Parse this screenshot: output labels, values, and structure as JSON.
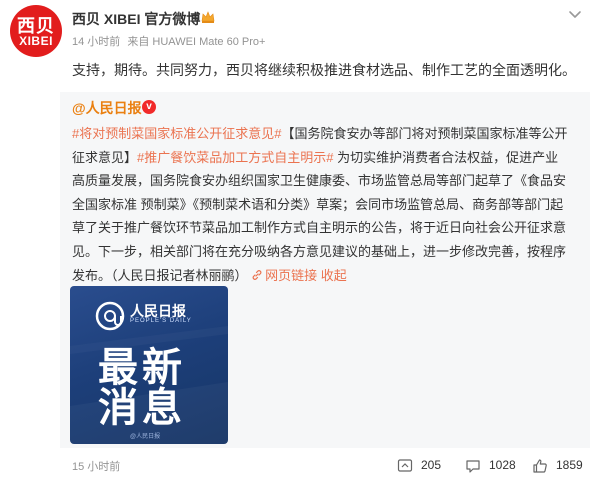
{
  "post": {
    "avatar": {
      "top": "西贝",
      "bottom": "XIBEI"
    },
    "author": "西贝 XIBEI 官方微博",
    "crown_icon": "crown-icon",
    "time": "14 小时前",
    "source": "来自 HUAWEI Mate 60 Pro+",
    "text": "支持，期待。共同努力，西贝将继续积极推进食材选品、制作工艺的全面透明化。"
  },
  "repost": {
    "author": "@人民日报",
    "verified_icon": "v-badge-icon",
    "tag1": "#将对预制菜国家标准公开征求意见#",
    "line1_rest": "【国务院食安办等部门将对预制菜国家标准等公开",
    "line2_start": "征求意见】",
    "tag2": "#推广餐饮菜品加工方式自主明示#",
    "line2_rest": " 为切实维护消费者合法权益，促进产业",
    "line3": "高质量发展，国务院食安办组织国家卫生健康委、市场监管总局等部门起草了《食品安",
    "line4": "全国家标准 预制菜》《预制菜术语和分类》草案；会同市场监管总局、商务部等部门起",
    "line5": "草了关于推广餐饮环节菜品加工制作方式自主明示的公告，将于近日向社会公开征求意",
    "line6": "见。下一步，相关部门将在充分吸纳各方意见建议的基础上，进一步修改完善，按程序",
    "line7": "发布。（人民日报记者林丽鹂）",
    "web_link": "网页链接",
    "collapse": "收起",
    "thumb": {
      "brand": "人民日报",
      "brand_en": "PEOPLE'S DAILY",
      "line1": "最新",
      "line2": "消息",
      "footer": "@人民日报"
    },
    "time": "15 小时前",
    "reposts": "205",
    "comments": "1028",
    "likes": "1859"
  },
  "colors": {
    "accent": "#eb7350",
    "brand_red": "#e21d1d",
    "repost_bg": "#f6f7f8",
    "meta_gray": "#939393"
  }
}
